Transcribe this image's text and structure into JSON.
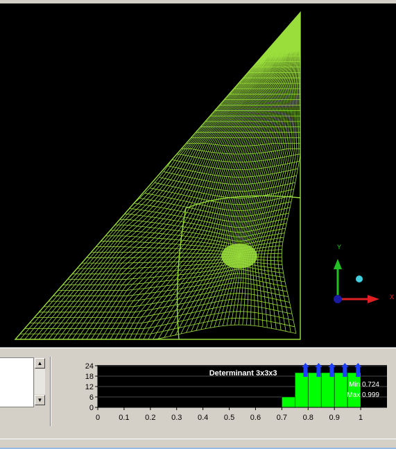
{
  "viewport": {
    "background": "#000000",
    "mesh_color": "#9ade3c",
    "axis_labels": {
      "y": "Y",
      "x": "X"
    },
    "axis_colors": {
      "y": "#22c022",
      "x": "#e02020",
      "origin": "#1a1aa0",
      "point": "#40d0e0"
    }
  },
  "chart_data": {
    "type": "bar",
    "title": "Determinant 3x3x3",
    "x": [
      0.7,
      0.75,
      0.8,
      0.85,
      0.9,
      0.95
    ],
    "values": [
      6,
      20,
      20,
      20,
      20,
      20
    ],
    "bin_width": 0.05,
    "xlim": [
      0,
      1.1
    ],
    "ylim": [
      0,
      24
    ],
    "xticks": [
      "0",
      "0.1",
      "0.2",
      "0.3",
      "0.4",
      "0.5",
      "0.6",
      "0.7",
      "0.8",
      "0.9",
      "1"
    ],
    "yticks": [
      "0",
      "6",
      "12",
      "18",
      "24"
    ],
    "min_label": "Min 0.724",
    "max_label": "Max 0.999",
    "bar_color": "#00ff00",
    "background": "#000000",
    "marker_color": "#1f3fff",
    "marker_x": [
      0.79,
      0.84,
      0.89,
      0.94,
      0.99
    ],
    "grid": true
  }
}
